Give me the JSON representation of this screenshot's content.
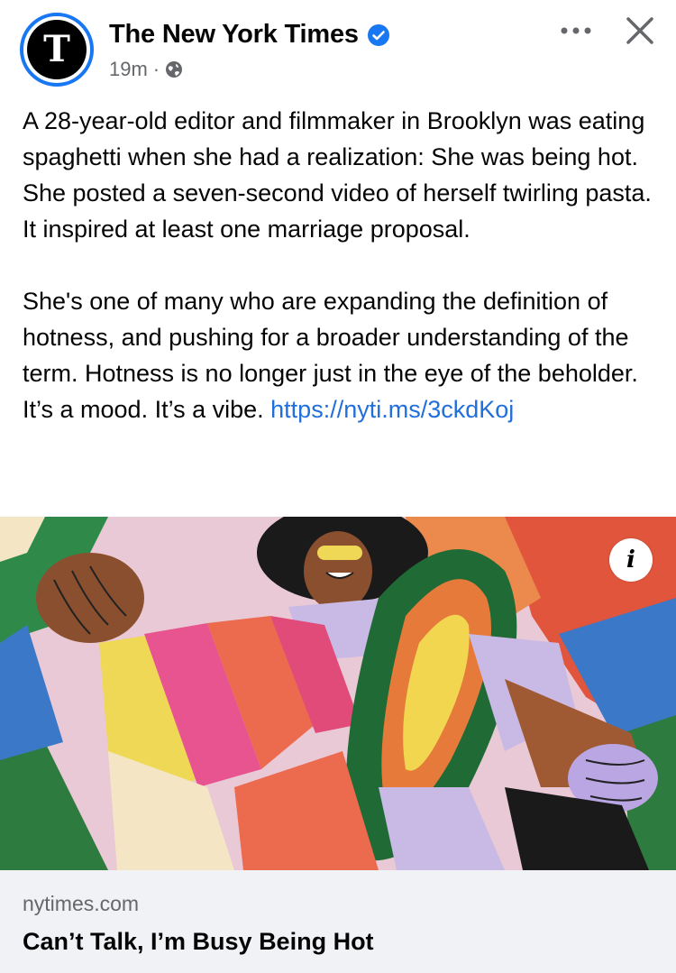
{
  "post": {
    "author": "The New York Times",
    "avatar_letter": "T",
    "time": "19m",
    "separator": "·",
    "paragraph1": "A 28-year-old editor and filmmaker in Brooklyn was eating spaghetti when she had a realization: She was being hot. She posted a seven-second video of herself twirling pasta. It inspired at least one marriage proposal.",
    "paragraph2": "She's one of many who are expanding the definition of hotness, and pushing for a broader understanding of the term. Hotness is no longer just in the eye of the beholder. It’s a mood. It’s a vibe.",
    "link_text": "https://nyti.ms/3ckdKoj"
  },
  "link_preview": {
    "domain": "nytimes.com",
    "title": "Can’t Talk, I’m Busy Being Hot",
    "info_glyph": "i"
  },
  "colors": {
    "verified": "#1877f2",
    "link": "#216fdb",
    "meta": "#65676b",
    "preview_bg": "#f0f2f5"
  },
  "icons": {
    "verified": "verified-badge-icon",
    "globe": "globe-icon",
    "more": "more-options-icon",
    "close": "close-icon",
    "info": "info-icon"
  }
}
